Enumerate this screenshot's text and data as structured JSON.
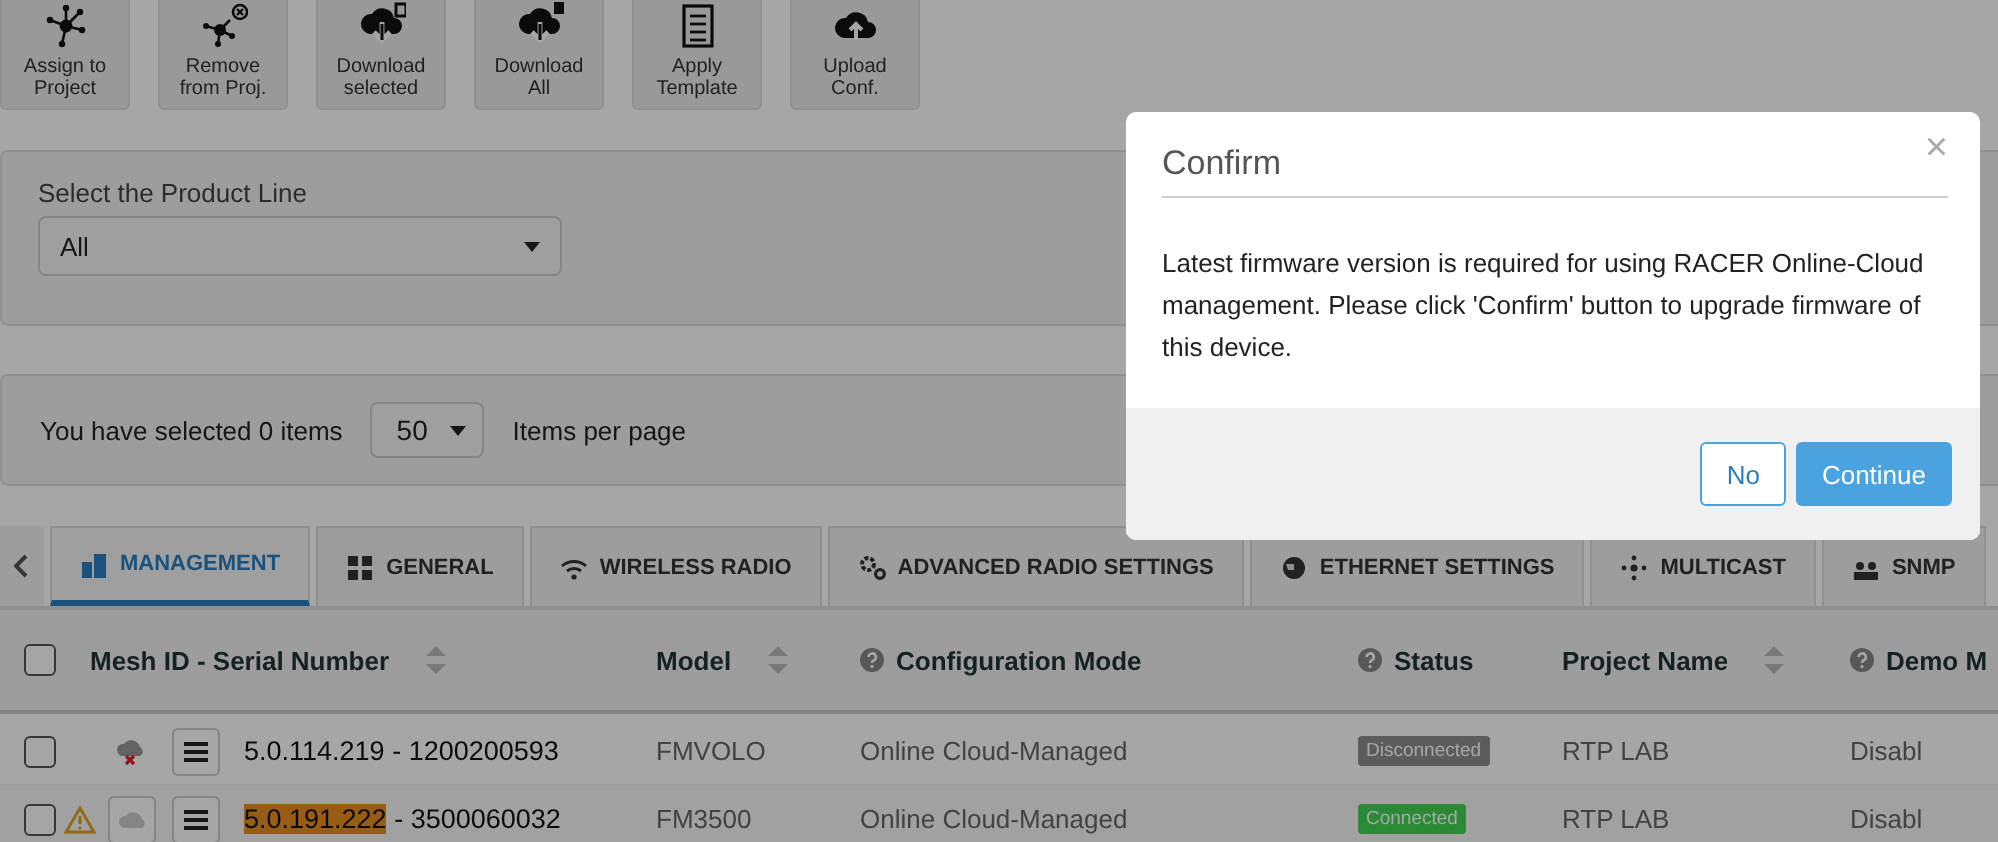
{
  "toolbar": [
    {
      "label": "Assign to Project"
    },
    {
      "label": "Remove from Proj."
    },
    {
      "label": "Download selected"
    },
    {
      "label": "Download All"
    },
    {
      "label": "Apply Template"
    },
    {
      "label": "Upload Conf."
    }
  ],
  "product_line": {
    "label": "Select the Product Line",
    "value": "All"
  },
  "paging": {
    "selected_text": "You have selected 0 items",
    "per_page": "50",
    "per_page_label": "Items per page"
  },
  "tabs": [
    {
      "label": "MANAGEMENT",
      "selected": true
    },
    {
      "label": "GENERAL",
      "selected": false
    },
    {
      "label": "WIRELESS RADIO",
      "selected": false
    },
    {
      "label": "ADVANCED RADIO SETTINGS",
      "selected": false
    },
    {
      "label": "ETHERNET SETTINGS",
      "selected": false
    },
    {
      "label": "MULTICAST",
      "selected": false
    },
    {
      "label": "SNMP",
      "selected": false
    }
  ],
  "table": {
    "select_all": {
      "checked": false
    },
    "columns": [
      {
        "label": "Mesh ID - Serial Number",
        "sortable": true,
        "help": false
      },
      {
        "label": "Model",
        "sortable": true,
        "help": false
      },
      {
        "label": "Configuration Mode",
        "sortable": false,
        "help": true
      },
      {
        "label": "Status",
        "sortable": false,
        "help": true
      },
      {
        "label": "Project Name",
        "sortable": true,
        "help": false
      },
      {
        "label": "Demo M",
        "sortable": false,
        "help": true
      }
    ],
    "rows": [
      {
        "checked": false,
        "warning": false,
        "kind": "offline",
        "mesh_id": "5.0.114.219",
        "highlighted": false,
        "serial": " - 1200200593",
        "model": "FMVOLO",
        "mode": "Online Cloud-Managed",
        "status": "Disconnected",
        "color": "#5c5c5c",
        "project": "RTP LAB",
        "demo": "Disabl"
      },
      {
        "checked": false,
        "warning": true,
        "kind": "upload",
        "mesh_id": "5.0.191.222",
        "highlighted": true,
        "serial": " - 3500060032",
        "model": "FM3500",
        "mode": "Online Cloud-Managed",
        "status": "Connected",
        "color": "#2a8a35",
        "project": "RTP LAB",
        "demo": "Disabl"
      }
    ]
  },
  "dialog": {
    "title": "Confirm",
    "close": "×",
    "message": "Latest firmware version is required for using RACER Online-Cloud management. Please click 'Confirm' button to upgrade firmware of this device.",
    "buttons": [
      {
        "label": "No",
        "kind": "secondary"
      },
      {
        "label": "Continue",
        "kind": "primary"
      }
    ]
  }
}
